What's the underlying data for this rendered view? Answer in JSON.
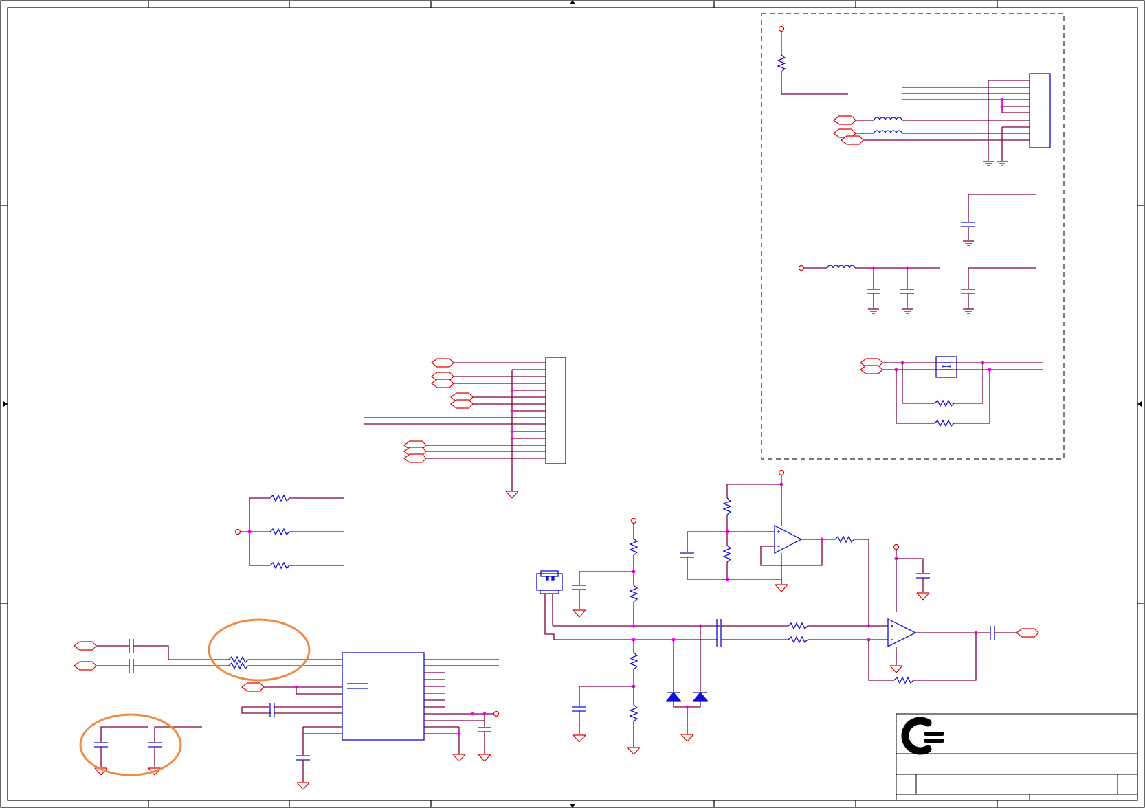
{
  "sheet": {
    "background": "#ffffff",
    "wire_color": "#c00000",
    "component_color": "#1010d0",
    "junction_color": "#ff00ff",
    "highlight_color": "#f08a40",
    "frame_color": "#000000"
  },
  "title_block": {
    "logo_icon": "company-logo-c-icon"
  }
}
